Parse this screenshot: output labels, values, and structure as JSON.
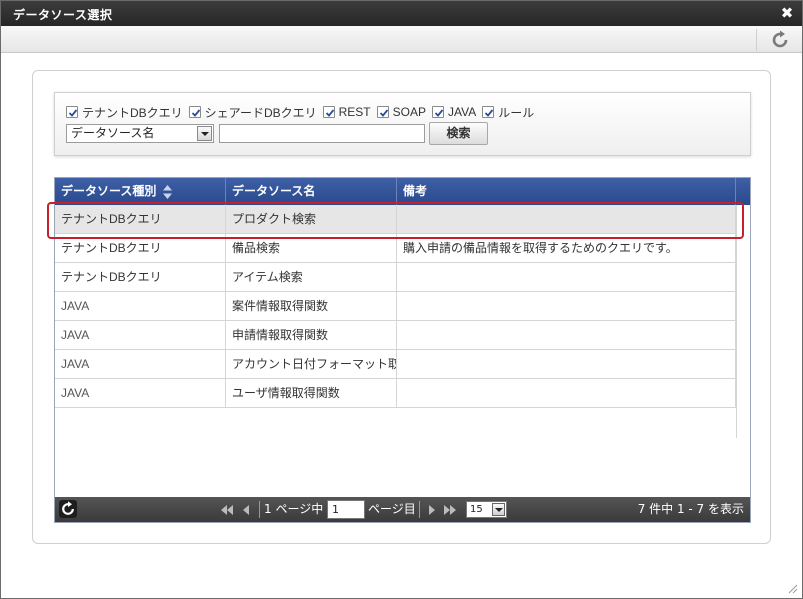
{
  "dialog": {
    "title": "データソース選択",
    "close_symbol": "✖"
  },
  "filters": {
    "checkboxes": [
      {
        "label": "テナントDBクエリ",
        "checked": true
      },
      {
        "label": "シェアードDBクエリ",
        "checked": true
      },
      {
        "label": "REST",
        "checked": true
      },
      {
        "label": "SOAP",
        "checked": true
      },
      {
        "label": "JAVA",
        "checked": true
      },
      {
        "label": "ルール",
        "checked": true
      }
    ],
    "field_select": "データソース名",
    "search_value": "",
    "search_button": "検索"
  },
  "grid": {
    "columns": [
      "データソース種別",
      "データソース名",
      "備考"
    ],
    "rows": [
      {
        "type": "テナントDBクエリ",
        "name": "プロダクト検索",
        "note": ""
      },
      {
        "type": "テナントDBクエリ",
        "name": "備品検索",
        "note": "購入申請の備品情報を取得するためのクエリです。"
      },
      {
        "type": "テナントDBクエリ",
        "name": "アイテム検索",
        "note": ""
      },
      {
        "type": "JAVA",
        "name": "案件情報取得関数",
        "note": ""
      },
      {
        "type": "JAVA",
        "name": "申請情報取得関数",
        "note": ""
      },
      {
        "type": "JAVA",
        "name": "アカウント日付フォーマット取得関数",
        "note": ""
      },
      {
        "type": "JAVA",
        "name": "ユーザ情報取得関数",
        "note": ""
      }
    ],
    "selected_row": 0
  },
  "pager": {
    "page_prefix": "1 ページ中",
    "current_page": "1",
    "page_suffix": "ページ目",
    "page_size": "15",
    "summary": "7 件中 1 - 7 を表示"
  },
  "colors": {
    "title_bar": "#2f2f2f",
    "grid_header": "#34549a",
    "highlight": "#c8202a",
    "pager_bar": "#464646"
  }
}
